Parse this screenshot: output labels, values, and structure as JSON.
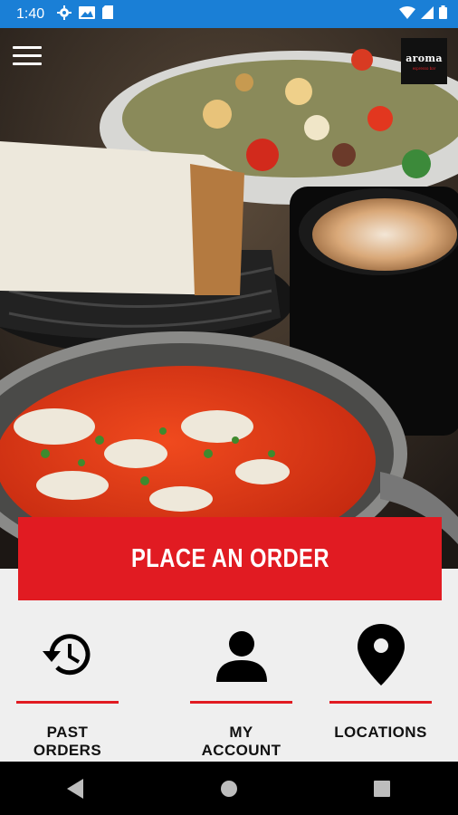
{
  "status_bar": {
    "time": "1:40",
    "icons_left": [
      "settings-icon",
      "image-icon",
      "sd-card-icon"
    ],
    "icons_right": [
      "wifi-icon",
      "signal-icon",
      "battery-icon"
    ]
  },
  "header": {
    "menu_icon": "hamburger-menu-icon",
    "logo_text": "aroma",
    "logo_tagline": "espresso bar",
    "logo_tagline_color": "#e32028"
  },
  "hero": {
    "image": "food-photo"
  },
  "order_button": {
    "label": "PLACE AN ORDER",
    "color": "#e11b22"
  },
  "nav_items": [
    {
      "label": "PAST ORDERS",
      "icon": "history-icon"
    },
    {
      "label": "MY ACCOUNT",
      "icon": "person-icon"
    },
    {
      "label": "LOCATIONS",
      "icon": "location-pin-icon"
    }
  ],
  "android_nav": [
    "back-icon",
    "home-icon",
    "recents-icon"
  ],
  "colors": {
    "status_bar": "#1a7fd6",
    "accent": "#e11b22",
    "panel": "#efefef"
  }
}
